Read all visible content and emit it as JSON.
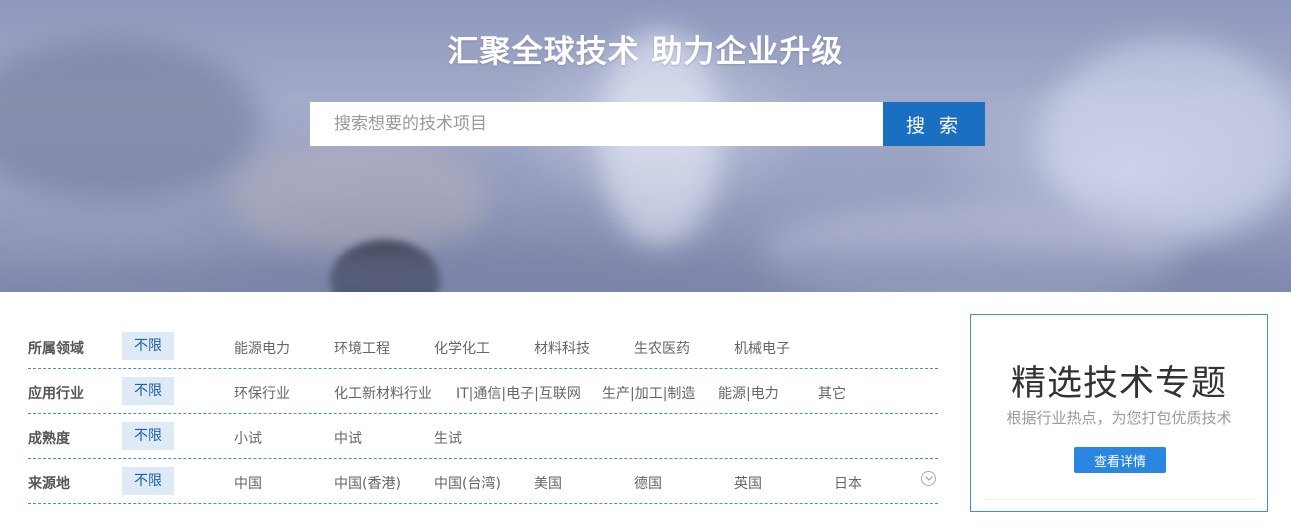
{
  "banner": {
    "title": "汇聚全球技术 助力企业升级",
    "search": {
      "placeholder": "搜索想要的技术项目",
      "value": "",
      "button_label": "搜 索"
    }
  },
  "filters": [
    {
      "label": "所属领域",
      "default": "不限",
      "options": [
        "能源电力",
        "环境工程",
        "化学化工",
        "材料科技",
        "生农医药",
        "机械电子"
      ]
    },
    {
      "label": "应用行业",
      "default": "不限",
      "options": [
        "环保行业",
        "化工新材料行业",
        "IT|通信|电子|互联网",
        "生产|加工|制造",
        "能源|电力",
        "其它"
      ]
    },
    {
      "label": "成熟度",
      "default": "不限",
      "options": [
        "小试",
        "中试",
        "生试"
      ]
    },
    {
      "label": "来源地",
      "default": "不限",
      "options": [
        "中国",
        "中国(香港)",
        "中国(台湾)",
        "美国",
        "德国",
        "英国",
        "日本"
      ]
    }
  ],
  "expand_icon": "chevron-down-circle-icon",
  "promo": {
    "title": "精选技术专题",
    "subtitle": "根据行业热点，为您打包优质技术",
    "button_label": "查看详情"
  },
  "colors": {
    "accent": "#1b6fc1",
    "selected_bg": "#dfeaf7",
    "divider": "#4a8ecb",
    "promo_border": "#3d8fd6",
    "promo_button": "#2a86e0"
  }
}
